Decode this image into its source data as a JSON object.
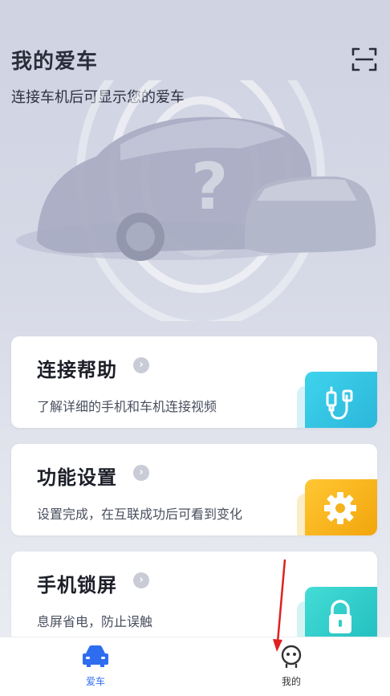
{
  "header": {
    "title": "我的爱车",
    "subtitle": "连接车机后可显示您的爱车"
  },
  "cards": [
    {
      "title": "连接帮助",
      "desc": "了解详细的手机和车机连接视频",
      "icon": "usb-cable-icon",
      "tile_color": "#33c6e0"
    },
    {
      "title": "功能设置",
      "desc": "设置完成，在互联成功后可看到变化",
      "icon": "gear-icon",
      "tile_color": "#f5b21e"
    },
    {
      "title": "手机锁屏",
      "desc": "息屏省电，防止误触",
      "icon": "lock-icon",
      "tile_color": "#2fcdc9"
    }
  ],
  "tabs": [
    {
      "label": "爱车",
      "icon": "car-icon",
      "active": true
    },
    {
      "label": "我的",
      "icon": "profile-icon",
      "active": false
    }
  ],
  "colors": {
    "accent": "#2f6df0",
    "inactive": "#333333",
    "annotation": "#e02020"
  }
}
